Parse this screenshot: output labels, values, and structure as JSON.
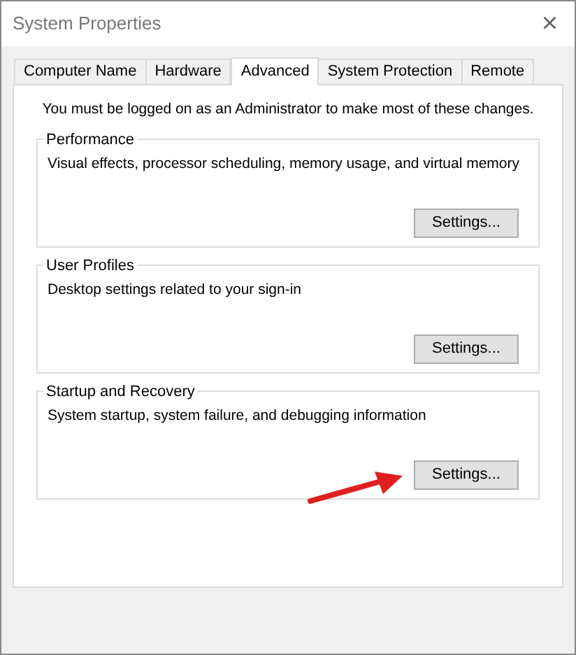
{
  "window": {
    "title": "System Properties",
    "close": "×"
  },
  "tabs": [
    {
      "label": "Computer Name",
      "selected": false
    },
    {
      "label": "Hardware",
      "selected": false
    },
    {
      "label": "Advanced",
      "selected": true
    },
    {
      "label": "System Protection",
      "selected": false
    },
    {
      "label": "Remote",
      "selected": false
    }
  ],
  "notice": "You must be logged on as an Administrator to make most of these changes.",
  "groups": [
    {
      "title": "Performance",
      "description": "Visual effects, processor scheduling, memory usage, and virtual memory",
      "button": "Settings...",
      "annotated": false
    },
    {
      "title": "User Profiles",
      "description": "Desktop settings related to your sign-in",
      "button": "Settings...",
      "annotated": false
    },
    {
      "title": "Startup and Recovery",
      "description": "System startup, system failure, and debugging information",
      "button": "Settings...",
      "annotated": true
    }
  ]
}
